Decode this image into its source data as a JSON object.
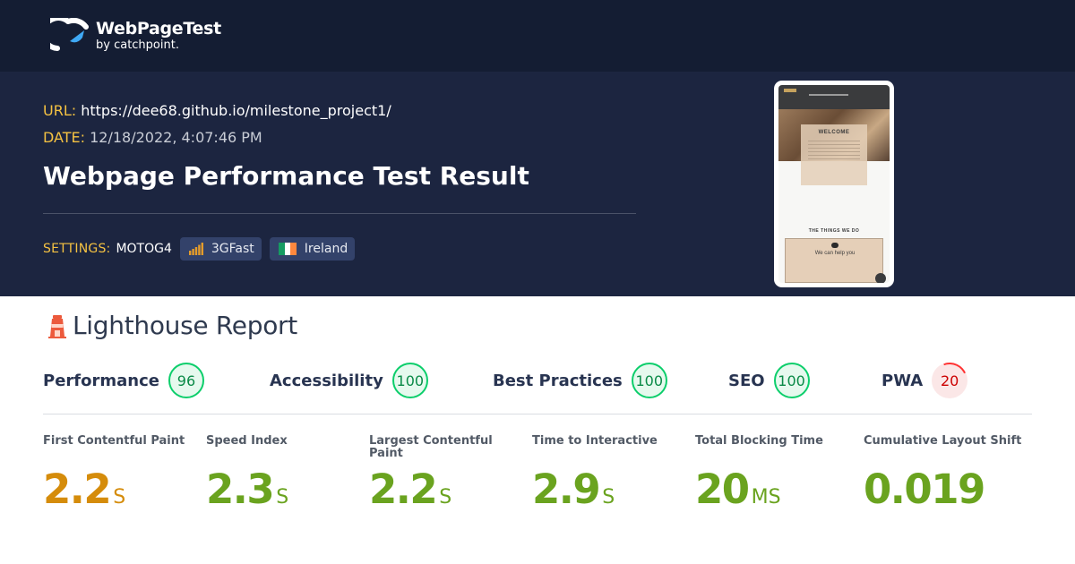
{
  "brand": {
    "name": "WebPageTest",
    "tagline": "by catchpoint."
  },
  "test": {
    "url_label": "URL:",
    "url": "https://dee68.github.io/milestone_project1/",
    "date_label": "DATE:",
    "date": "12/18/2022, 4:07:46 PM",
    "heading": "Webpage Performance Test Result"
  },
  "settings": {
    "label": "SETTINGS:",
    "device": "MOTOG4",
    "connection": "3GFast",
    "location": "Ireland"
  },
  "screenshot": {
    "welcome": "WELCOME",
    "section_title": "THE THINGS WE DO",
    "card_text": "We can help you"
  },
  "lighthouse": {
    "title": "Lighthouse Report",
    "categories": [
      {
        "name": "Performance",
        "score": "96",
        "status": "pass"
      },
      {
        "name": "Accessibility",
        "score": "100",
        "status": "pass"
      },
      {
        "name": "Best Practices",
        "score": "100",
        "status": "pass"
      },
      {
        "name": "SEO",
        "score": "100",
        "status": "pass"
      },
      {
        "name": "PWA",
        "score": "20",
        "status": "fail"
      }
    ],
    "metrics": [
      {
        "name": "First Contentful Paint",
        "value": "2.2",
        "unit": "S",
        "color": "#d58c0b"
      },
      {
        "name": "Speed Index",
        "value": "2.3",
        "unit": "S",
        "color": "#6aa31f"
      },
      {
        "name": "Largest Contentful Paint",
        "value": "2.2",
        "unit": "S",
        "color": "#6aa31f"
      },
      {
        "name": "Time to Interactive",
        "value": "2.9",
        "unit": "S",
        "color": "#6aa31f"
      },
      {
        "name": "Total Blocking Time",
        "value": "20",
        "unit": "MS",
        "color": "#6aa31f"
      },
      {
        "name": "Cumulative Layout Shift",
        "value": "0.019",
        "unit": "",
        "color": "#6aa31f"
      }
    ]
  },
  "colors": {
    "header_bg": "#141d33",
    "hero_bg": "#1c2540",
    "label_accent": "#f5c242",
    "pass": "#0cce6b",
    "fail": "#ff3333"
  },
  "icons": [
    "webpagetest-logo-icon",
    "signal-bars-icon",
    "ireland-flag-icon",
    "lighthouse-icon"
  ]
}
